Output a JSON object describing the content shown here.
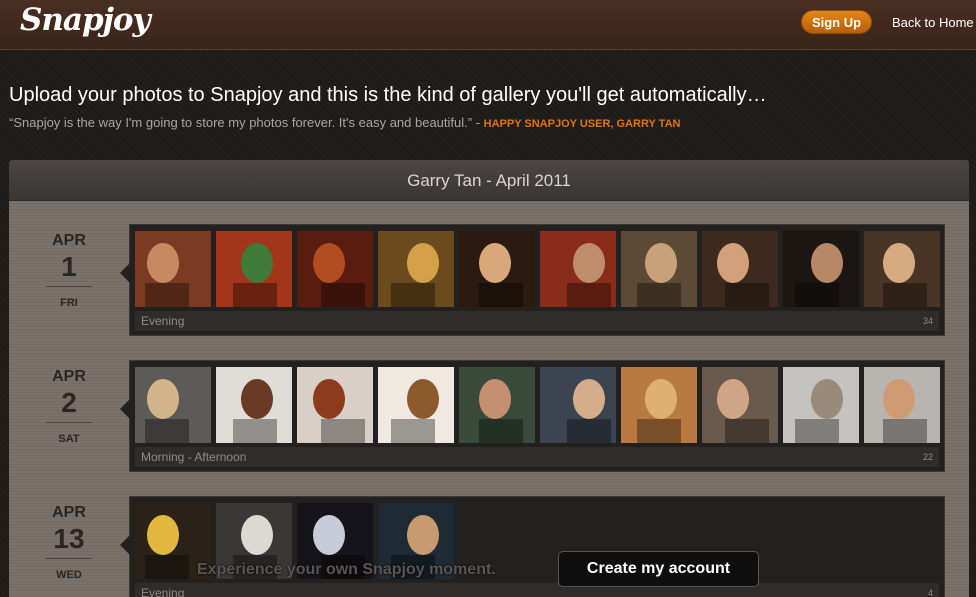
{
  "header": {
    "logo": "Snapjoy",
    "signup": "Sign Up",
    "back_home": "Back to Home"
  },
  "intro": {
    "headline": "Upload your photos to Snapjoy and this is the kind of gallery you'll get automatically…",
    "quote": "“Snapjoy is the way I'm going to store my photos forever. It's easy and beautiful.” - ",
    "quote_by": "HAPPY SNAPJOY USER, GARRY TAN"
  },
  "gallery": {
    "title": "Garry Tan - April 2011",
    "days": [
      {
        "month": "APR",
        "day": "1",
        "weekday": "FRI",
        "label": "Evening",
        "count": "34",
        "photos": [
          {
            "bg": "#7b3b22",
            "fg": "#c68a62"
          },
          {
            "bg": "#a2351a",
            "fg": "#3f7a3a"
          },
          {
            "bg": "#5a1c0f",
            "fg": "#b24d22"
          },
          {
            "bg": "#6b4a1d",
            "fg": "#d4a04a"
          },
          {
            "bg": "#2a1a10",
            "fg": "#d9a77a"
          },
          {
            "bg": "#8a2c1a",
            "fg": "#bf8d6a"
          },
          {
            "bg": "#5c4a36",
            "fg": "#c8a07a"
          },
          {
            "bg": "#3d2a1c",
            "fg": "#d3a07c"
          },
          {
            "bg": "#1c1612",
            "fg": "#b88766"
          },
          {
            "bg": "#4a3426",
            "fg": "#d7ab82"
          }
        ]
      },
      {
        "month": "APR",
        "day": "2",
        "weekday": "SAT",
        "label": "Morning - Afternoon",
        "count": "22",
        "photos": [
          {
            "bg": "#5d5b58",
            "fg": "#d2b48a"
          },
          {
            "bg": "#e0ddd8",
            "fg": "#6a3a26"
          },
          {
            "bg": "#d8cfc6",
            "fg": "#8e3a1c"
          },
          {
            "bg": "#efe9e1",
            "fg": "#8c5a2c"
          },
          {
            "bg": "#3a4a3a",
            "fg": "#c49070"
          },
          {
            "bg": "#3b4450",
            "fg": "#d6ad8a"
          },
          {
            "bg": "#b87a40",
            "fg": "#e0b070"
          },
          {
            "bg": "#6a5a4e",
            "fg": "#cfa585"
          },
          {
            "bg": "#c5c3c0",
            "fg": "#9a8a7a"
          },
          {
            "bg": "#b8b4b0",
            "fg": "#d09a72"
          }
        ]
      },
      {
        "month": "APR",
        "day": "13",
        "weekday": "WED",
        "label": "Evening",
        "count": "4",
        "photos": [
          {
            "bg": "#2a2218",
            "fg": "#e2b840"
          },
          {
            "bg": "#3a3836",
            "fg": "#dcd8d2"
          },
          {
            "bg": "#14141a",
            "fg": "#c8ccd8"
          },
          {
            "bg": "#1e2a34",
            "fg": "#c89a70"
          }
        ]
      }
    ]
  },
  "cta": {
    "tagline": "Experience your own Snapjoy moment.",
    "button": "Create my account"
  }
}
